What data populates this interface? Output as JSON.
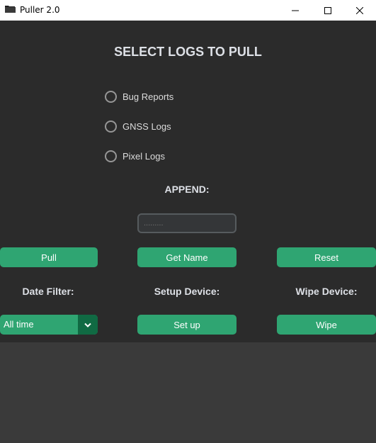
{
  "window": {
    "title": "Puller 2.0",
    "icons": {
      "app": "folder-icon",
      "minimize": "minimize-icon",
      "maximize": "maximize-icon",
      "close": "close-icon"
    }
  },
  "main": {
    "heading": "SELECT LOGS TO PULL",
    "log_options": [
      {
        "label": "Bug Reports",
        "selected": false
      },
      {
        "label": "GNSS Logs",
        "selected": false
      },
      {
        "label": "Pixel Logs",
        "selected": false
      }
    ],
    "append_label": "APPEND:",
    "append_input": {
      "value": "",
      "placeholder": "........."
    },
    "buttons": {
      "pull": "Pull",
      "get_name": "Get Name",
      "reset": "Reset",
      "setup": "Set up",
      "wipe": "Wipe"
    },
    "date_filter_label": "Date Filter:",
    "setup_label": "Setup Device:",
    "wipe_label": "Wipe Device:",
    "date_filter": {
      "selected": "All time"
    }
  },
  "colors": {
    "accent": "#2fa572",
    "accent_dark": "#106a43",
    "panel_bg": "#2b2b2b",
    "window_bg": "#3a3a3a",
    "text": "#dde0e6"
  }
}
